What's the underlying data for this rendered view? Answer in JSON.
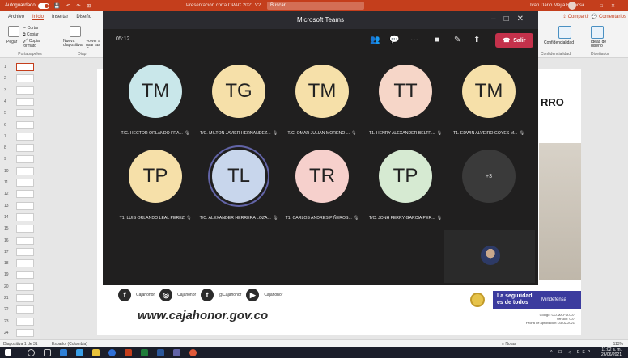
{
  "ppt": {
    "autosave_label": "Autoguardado",
    "doc_title": "Presentación corta OPAC 2021 V2",
    "search_placeholder": "Buscar",
    "user_name": "Ivan Dario Mejia Barbosa",
    "tabs": [
      "Archivo",
      "Inicio",
      "Insertar",
      "Diseño"
    ],
    "active_tab": "Inicio",
    "share_label": "Compartir",
    "comments_label": "Comentarios",
    "ribbon": {
      "cut": "Cortar",
      "copy": "Copiar",
      "paste": "Pegar",
      "format_painter": "Copiar formato",
      "clipboard_group": "Portapapeles",
      "new_slide": "Nueva diapositiva",
      "reuse": "Volver a usar las diap.",
      "slides_group": "Diap.",
      "confidential": "Confidencialidad",
      "design_ideas": "Ideas de diseño",
      "designer_group": "Diseñador"
    },
    "thumbnails": [
      "1",
      "2",
      "3",
      "4",
      "5",
      "6",
      "7",
      "8",
      "9",
      "10",
      "11",
      "12",
      "13",
      "14",
      "15",
      "16",
      "17",
      "18",
      "19",
      "20",
      "21",
      "22",
      "23",
      "24"
    ],
    "active_thumbnail": 1,
    "slide": {
      "heading": "RRO",
      "social": [
        "Cajahonor",
        "Cajahonor",
        "@Cajahonor",
        "Cajahonor"
      ],
      "website": "www.cajahonor.gov.co",
      "seguridad": "La seguridad es de todos",
      "mindefensa": "Mindefensa",
      "doc_code_lines": [
        "Código: CO-MA-FM-007",
        "Versión: 007",
        "Fecha de aprobación: 03-02-2021"
      ]
    },
    "status": {
      "slide_count": "Diapositiva 1 de 31",
      "language": "Español (Colombia)",
      "notes": "Notas",
      "zoom": "113%"
    },
    "taskbar": {
      "time": "11:02 a. m.",
      "date": "26/06/2021",
      "lang": "ESP"
    }
  },
  "teams": {
    "window_title": "Microsoft Teams",
    "call_timer": "05:12",
    "leave_label": "Salir",
    "participants": [
      {
        "initials": "TM",
        "name": "T/C. HECTOR ORLANDO FRA...",
        "color": "#c9e7ea",
        "speaking": false
      },
      {
        "initials": "TG",
        "name": "T/C. MILTON JAVIER HERNANDEZ...",
        "color": "#f6e0a9",
        "speaking": false
      },
      {
        "initials": "TM",
        "name": "T/C. OMAR JULIAN MORENO ...",
        "color": "#f6e0a9",
        "speaking": false
      },
      {
        "initials": "TT",
        "name": "T1. HENRY ALEXANDER BELTR...",
        "color": "#f6d6c8",
        "speaking": false
      },
      {
        "initials": "TM",
        "name": "T1. EDWIN ALVEIRO GOYES M...",
        "color": "#f6e0a9",
        "speaking": false
      },
      {
        "initials": "TP",
        "name": "T1. LUIS ORLANDO LEAL PEREZ",
        "color": "#f6e0a9",
        "speaking": false
      },
      {
        "initials": "TL",
        "name": "T/C. ALEXANDER HERRERA LOZA...",
        "color": "#c8d6ec",
        "speaking": true
      },
      {
        "initials": "TR",
        "name": "T1. CARLOS ANDRES PIÑEROS...",
        "color": "#f6d0cc",
        "speaking": false
      },
      {
        "initials": "TP",
        "name": "T/C. JONH FERRY GARCIA PER...",
        "color": "#d6ead2",
        "speaking": false
      }
    ],
    "overflow_count": "+3"
  }
}
